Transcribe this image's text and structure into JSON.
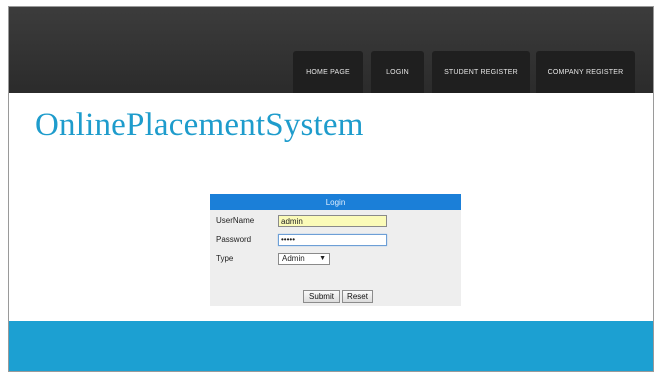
{
  "nav": {
    "items": [
      {
        "label": "HOME PAGE"
      },
      {
        "label": "LOGIN"
      },
      {
        "label": "STUDENT REGISTER"
      },
      {
        "label": "COMPANY REGISTER"
      }
    ]
  },
  "site": {
    "title": "OnlinePlacementSystem"
  },
  "login": {
    "header": "Login",
    "username_label": "UserName",
    "username_value": "admin",
    "password_label": "Password",
    "password_value": "•••••",
    "type_label": "Type",
    "type_selected": "Admin",
    "submit_label": "Submit",
    "reset_label": "Reset"
  },
  "colors": {
    "accent": "#1e9ccc",
    "header_blue": "#1b7fd8",
    "footer": "#1ca0d2",
    "topbar": "#2f2f2f"
  }
}
